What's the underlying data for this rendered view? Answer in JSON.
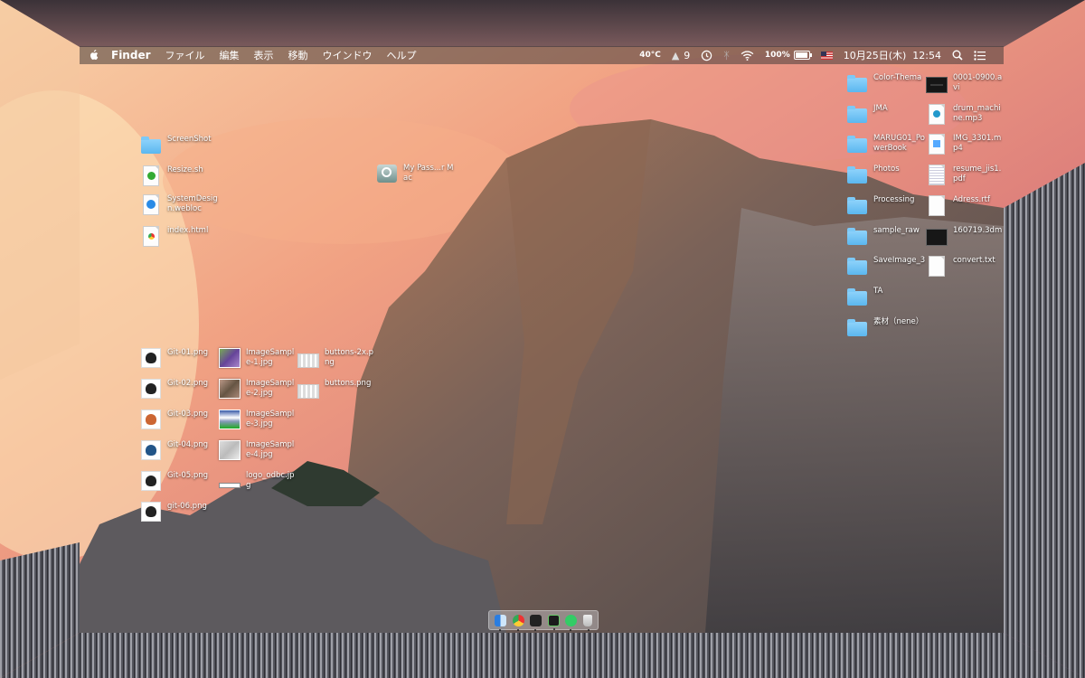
{
  "menubar": {
    "app_name": "Finder",
    "menus": [
      "ファイル",
      "編集",
      "表示",
      "移動",
      "ウインドウ",
      "ヘルプ"
    ],
    "status": {
      "temperature": "40°C",
      "adobe_badge": "9",
      "battery": "100%",
      "date": "10月25日(木)",
      "time": "12:54"
    }
  },
  "desktop": {
    "left_group": [
      {
        "label": "ScreenShot",
        "icon": "folder-icon"
      },
      {
        "label": "Resize.sh",
        "icon": "script-icon"
      },
      {
        "label": "SystemDesign.webloc",
        "icon": "webloc-icon"
      },
      {
        "label": "index.html",
        "icon": "chrome-icon"
      }
    ],
    "drive": {
      "label": "My Pass...r Mac",
      "icon": "time-machine-drive-icon"
    },
    "git_files": [
      {
        "label": "Git-01.png"
      },
      {
        "label": "Git-02.png"
      },
      {
        "label": "Git-03.png"
      },
      {
        "label": "Git-04.png"
      },
      {
        "label": "Git-05.png"
      },
      {
        "label": "git-06.png"
      }
    ],
    "sample_files": [
      {
        "label": "ImageSample-1.jpg",
        "icon": "photo-icon"
      },
      {
        "label": "ImageSample-2.jpg",
        "icon": "photo-icon"
      },
      {
        "label": "ImageSample-3.jpg",
        "icon": "gradient-image-icon"
      },
      {
        "label": "ImageSample-4.jpg",
        "icon": "photo-icon"
      },
      {
        "label": "logo_odbc.jpg",
        "icon": "logo-image-icon"
      }
    ],
    "button_files": [
      {
        "label": "buttons-2x.png",
        "icon": "grid-image-icon"
      },
      {
        "label": "buttons.png",
        "icon": "grid-image-icon"
      }
    ],
    "right_folders": [
      {
        "label": "Color-Thema"
      },
      {
        "label": "JMA"
      },
      {
        "label": "MARUG01_PowerBook"
      },
      {
        "label": "Photos"
      },
      {
        "label": "Processing"
      },
      {
        "label": "sample_raw"
      },
      {
        "label": "SaveImage_3"
      },
      {
        "label": "TA"
      },
      {
        "label": "素材（nene）"
      }
    ],
    "right_files": [
      {
        "label": "0001-0900.avi",
        "icon": "movie-icon"
      },
      {
        "label": "drum_machine.mp3",
        "icon": "audio-file-icon"
      },
      {
        "label": "IMG_3301.mp4",
        "icon": "video-file-icon"
      },
      {
        "label": "resume_jis1.pdf",
        "icon": "pdf-icon"
      },
      {
        "label": "Adress.rtf",
        "icon": "rtf-icon"
      },
      {
        "label": "160719.3dm",
        "icon": "3dm-file-icon"
      },
      {
        "label": "convert.txt",
        "icon": "text-file-icon"
      }
    ]
  },
  "dock": {
    "items": [
      "finder-icon",
      "chrome-icon",
      "terminal-icon",
      "activity-monitor-icon",
      "facetime-icon",
      "trash-icon"
    ]
  },
  "colors": {
    "folder": "#5bb7ef",
    "menubar_text": "#ffffff",
    "sky_top": "#e07a70",
    "sky_bottom": "#f5b783",
    "rock": "#7a6a60"
  }
}
